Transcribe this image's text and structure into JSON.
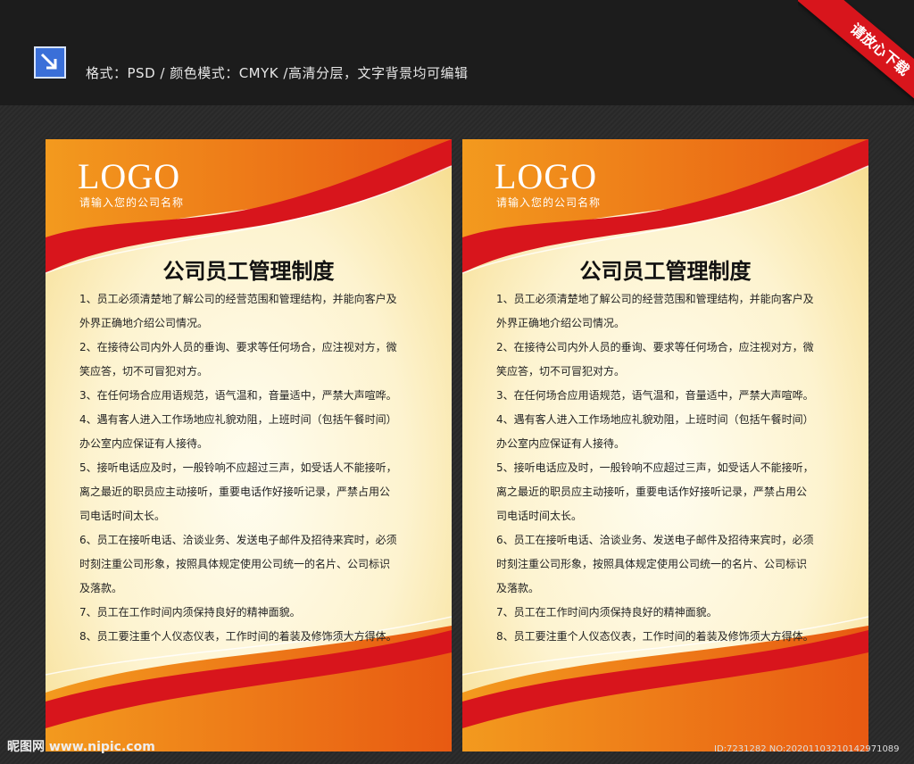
{
  "header": {
    "info_text": "格式：PSD  /  颜色模式：CMYK  /高清分层，文字背景均可编辑",
    "icon": "arrow-down-right-icon",
    "ribbon_label": "请放心下载"
  },
  "posters": [
    {
      "logo": "LOGO",
      "company": "请输入您的公司名称",
      "title": "公司员工管理制度",
      "rules": [
        "1、员工必须清楚地了解公司的经营范围和管理结构，并能向客户及",
        "外界正确地介绍公司情况。",
        "2、在接待公司内外人员的垂询、要求等任何场合，应注视对方，微",
        "笑应答，切不可冒犯对方。",
        "3、在任何场合应用语规范，语气温和，音量适中，严禁大声喧哗。",
        "4、遇有客人进入工作场地应礼貌劝阻，上班时间（包括午餐时间）",
        "办公室内应保证有人接待。",
        "5、接听电话应及时，一般铃响不应超过三声，如受话人不能接听，",
        "离之最近的职员应主动接听，重要电话作好接听记录，严禁占用公",
        "司电话时间太长。",
        "6、员工在接听电话、洽谈业务、发送电子邮件及招待来宾时，必须",
        "时刻注重公司形象，按照具体规定使用公司统一的名片、公司标识",
        "及落款。",
        "7、员工在工作时间内须保持良好的精神面貌。",
        "8、员工要注重个人仪态仪表，工作时间的着装及修饰须大方得体。"
      ]
    },
    {
      "logo": "LOGO",
      "company": "请输入您的公司名称",
      "title": "公司员工管理制度",
      "rules": [
        "1、员工必须清楚地了解公司的经营范围和管理结构，并能向客户及",
        "外界正确地介绍公司情况。",
        "2、在接待公司内外人员的垂询、要求等任何场合，应注视对方，微",
        "笑应答，切不可冒犯对方。",
        "3、在任何场合应用语规范，语气温和，音量适中，严禁大声喧哗。",
        "4、遇有客人进入工作场地应礼貌劝阻，上班时间（包括午餐时间）",
        "办公室内应保证有人接待。",
        "5、接听电话应及时，一般铃响不应超过三声，如受话人不能接听，",
        "离之最近的职员应主动接听，重要电话作好接听记录，严禁占用公",
        "司电话时间太长。",
        "6、员工在接听电话、洽谈业务、发送电子邮件及招待来宾时，必须",
        "时刻注重公司形象，按照具体规定使用公司统一的名片、公司标识",
        "及落款。",
        "7、员工在工作时间内须保持良好的精神面貌。",
        "8、员工要注重个人仪态仪表，工作时间的着装及修饰须大方得体。"
      ]
    }
  ],
  "watermark": {
    "site": "昵图网 www.nipic.com",
    "id": "ID:7231282 NO:20201103210142971089"
  },
  "colors": {
    "orange": "#f07a14",
    "red": "#d8151c",
    "cream": "#fdf3cf"
  }
}
